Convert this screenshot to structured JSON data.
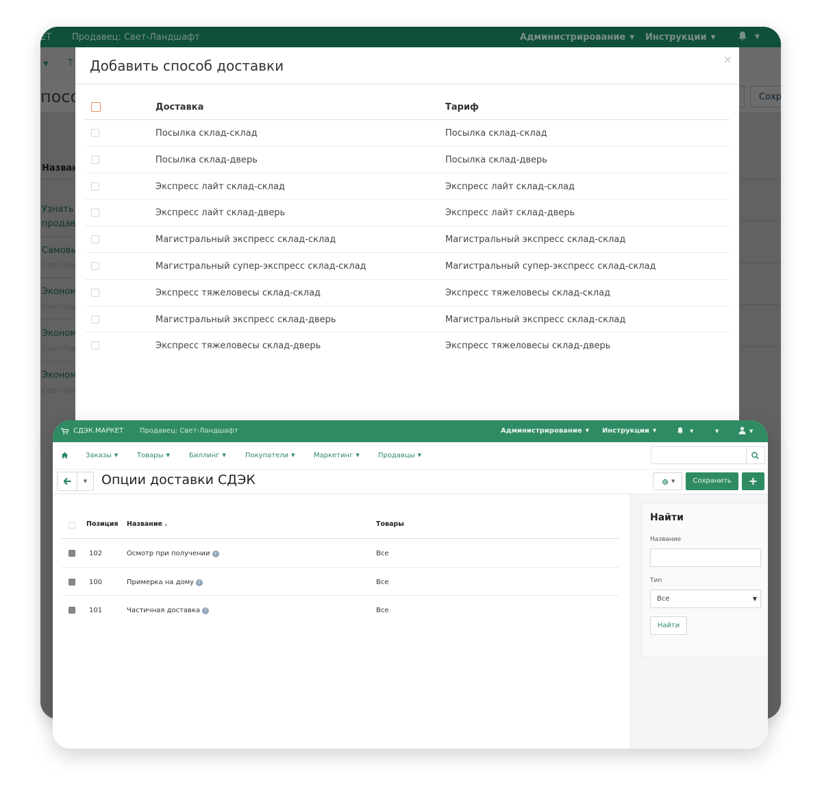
{
  "back": {
    "topbar": {
      "app_fragment": "ЕТ",
      "seller": "Продавец: Свет-Ландшафт",
      "admin": "Администрирование",
      "instructions": "Инструкции"
    },
    "nav_fragment": "Т",
    "title_fragment": "посо",
    "save_fragment": "Сохр",
    "list": {
      "header_fragment": "Назван",
      "items": [
        {
          "line1": "Узнать",
          "line2": "продав"
        },
        {
          "line1": "Самовы",
          "sub": "Свет-Лан"
        },
        {
          "line1": "Эконом",
          "sub": "Свет-Лан"
        },
        {
          "line1": "Эконом",
          "sub": "Свет-Лан"
        },
        {
          "line1": "Эконом",
          "sub": "Свет-Лан"
        }
      ]
    },
    "modal": {
      "title": "Добавить способ доставки",
      "close": "×",
      "columns": {
        "delivery": "Доставка",
        "tariff": "Тариф"
      },
      "rows": [
        {
          "delivery": "Посылка склад-склад",
          "tariff": "Посылка склад-склад"
        },
        {
          "delivery": "Посылка склад-дверь",
          "tariff": "Посылка склад-дверь"
        },
        {
          "delivery": "Экспресс лайт склад-склад",
          "tariff": "Экспресс лайт склад-склад"
        },
        {
          "delivery": "Экспресс лайт склад-дверь",
          "tariff": "Экспресс лайт склад-дверь"
        },
        {
          "delivery": "Магистральный экспресс склад-склад",
          "tariff": "Магистральный экспресс склад-склад"
        },
        {
          "delivery": "Магистральный супер-экспресс склад-склад",
          "tariff": "Магистральный супер-экспресс склад-склад"
        },
        {
          "delivery": "Экспресс тяжеловесы склад-склад",
          "tariff": "Экспресс тяжеловесы склад-склад"
        },
        {
          "delivery": "Магистральный экспресс склад-дверь",
          "tariff": "Магистральный экспресс склад-склад"
        },
        {
          "delivery": "Экспресс тяжеловесы склад-дверь",
          "tariff": "Экспресс тяжеловесы склад-дверь"
        }
      ]
    }
  },
  "front": {
    "topbar": {
      "brand": "СДЭК.МАРКЕТ",
      "seller": "Продавец: Свет-Ландшафт",
      "admin": "Администрирование",
      "instructions": "Инструкции"
    },
    "nav": [
      "Заказы",
      "Товары",
      "Биллинг",
      "Покупатели",
      "Маркетинг",
      "Продавцы"
    ],
    "title": "Опции доставки СДЭК",
    "save_label": "Сохранить",
    "plus_label": "+",
    "table": {
      "columns": {
        "position": "Позиция",
        "name": "Название",
        "sort_marker": "▴",
        "goods": "Товары"
      },
      "rows": [
        {
          "position": "102",
          "name": "Осмотр при получении",
          "goods": "Все"
        },
        {
          "position": "100",
          "name": "Примерка на дому",
          "goods": "Все"
        },
        {
          "position": "101",
          "name": "Частичная доставка",
          "goods": "Все"
        }
      ]
    },
    "filter": {
      "title": "Найти",
      "name_label": "Название",
      "type_label": "Тип",
      "type_value": "Все",
      "find_button": "Найти"
    },
    "colors": {
      "brand_green": "#2f8b63",
      "dark_green": "#0f4f3c"
    },
    "icons": [
      "cart-icon",
      "home-icon",
      "search-icon",
      "back-arrow-icon",
      "gear-icon",
      "bell-icon",
      "user-icon",
      "help-icon"
    ]
  }
}
